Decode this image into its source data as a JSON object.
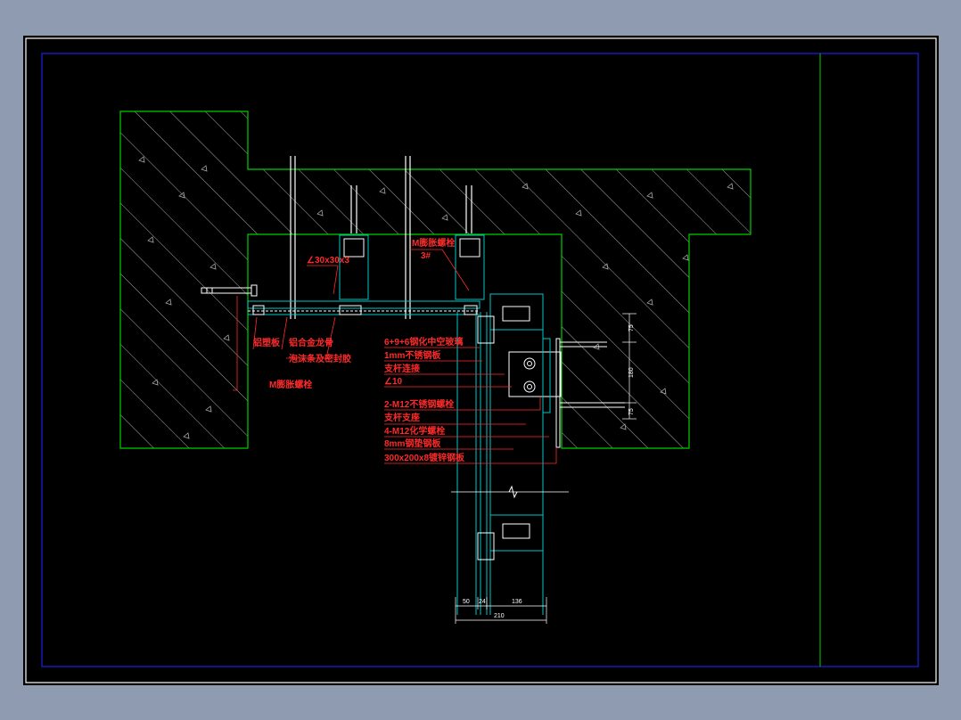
{
  "colors": {
    "background": "#000000",
    "frame": "#ffffff",
    "border_blue": "#1f1fe6",
    "structure_green": "#00d000",
    "annotation_red": "#ff2a2a",
    "member_cyan": "#00c8c8",
    "hatch": "#b0b0b0"
  },
  "labels": {
    "angle_steel": "∠30x30x3",
    "expansion_bolt_top": "M膨胀螺栓",
    "expansion_bolt_top_size": "3#",
    "aluminum_board": "铝塑板",
    "aluminum_alloy_keel": "铝合金龙骨",
    "foam_and_sealant": "泡沫条及密封胶",
    "expansion_bolt_left": "M膨胀螺栓",
    "glass": "6+9+6钢化中空玻璃",
    "stainless_plate": "1mm不锈钢板",
    "support_plate": "支杆连接",
    "angle_10": "∠10",
    "stainless_bolts": "2-M12不锈钢螺栓",
    "steel_support": "支杆支座",
    "chemical_bolts": "4-M12化学螺栓",
    "steel_plate_8": "8mm钢垫钢板",
    "embedded_plate": "300x200x8镀锌钢板"
  },
  "dimensions": {
    "right_top": "75",
    "right_mid": "180",
    "right_bot": "75",
    "bottom_1": "50",
    "bottom_2": "24",
    "bottom_3": "136",
    "bottom_total": "210"
  }
}
